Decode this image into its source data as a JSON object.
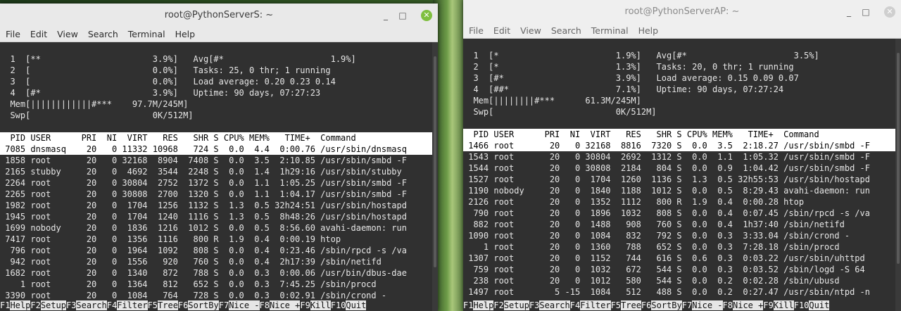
{
  "windows": [
    {
      "title": "root@PythonServerS: ~",
      "menu": [
        "File",
        "Edit",
        "View",
        "Search",
        "Terminal",
        "Help"
      ],
      "lines": [
        "  1  [**                      3.9%]   Avg[#*                     1.9%]",
        "  2  [                        0.0%]   Tasks: 25, 0 thr; 1 running",
        "  3  [                        0.0%]   Load average: 0.20 0.23 0.14",
        "  4  [#*                      3.9%]   Uptime: 90 days, 07:27:23",
        "  Mem[||||||||||||#***    97.7M/245M]",
        "  Swp[                        0K/512M]",
        "",
        "  PID USER      PRI  NI  VIRT   RES   SHR S CPU% MEM%   TIME+  Command",
        " 7085 dnsmasq    20   0 11332 10968   724 S  0.0  4.4  0:00.76 /usr/sbin/dnsmasq",
        " 1858 root       20   0 32168  8904  7408 S  0.0  3.5  2:10.85 /usr/sbin/smbd -F",
        " 2165 stubby     20   0  4692  3544  2248 S  0.0  1.4  1h29:16 /usr/sbin/stubby",
        " 2264 root       20   0 30804  2752  1372 S  0.0  1.1  1:05.25 /usr/sbin/smbd -F",
        " 2265 root       20   0 30808  2700  1320 S  0.0  1.1  1:04.17 /usr/sbin/smbd -F",
        " 1982 root       20   0  1704  1256  1132 S  1.3  0.5 32h24:51 /usr/sbin/hostapd",
        " 1945 root       20   0  1704  1240  1116 S  1.3  0.5  8h48:26 /usr/sbin/hostapd",
        " 1699 nobody     20   0  1836  1216  1012 S  0.0  0.5  8:56.60 avahi-daemon: run",
        " 7417 root       20   0  1356  1116   800 R  1.9  0.4  0:00.19 htop",
        "  796 root       20   0  1964  1092   808 S  0.0  0.4  0:23.46 /sbin/rpcd -s /va",
        "  942 root       20   0  1556   920   760 S  0.0  0.4  2h17:39 /sbin/netifd",
        " 1682 root       20   0  1340   872   788 S  0.0  0.3  0:00.06 /usr/bin/dbus-dae",
        "    1 root       20   0  1364   812   652 S  0.0  0.3  7:45.25 /sbin/procd",
        " 3390 root       20   0  1084   764   728 S  0.0  0.3  0:02.91 /sbin/crond -"
      ],
      "fkeys": [
        [
          "F1",
          "Help"
        ],
        [
          "F2",
          "Setup"
        ],
        [
          "F3",
          "Search"
        ],
        [
          "F4",
          "Filter"
        ],
        [
          "F5",
          "Tree"
        ],
        [
          "F6",
          "SortBy"
        ],
        [
          "F7",
          "Nice -"
        ],
        [
          "F8",
          "Nice +"
        ],
        [
          "F9",
          "Kill"
        ],
        [
          "F10",
          "Quit"
        ]
      ]
    },
    {
      "title": "root@PythonServerAP: ~",
      "menu": [
        "File",
        "Edit",
        "View",
        "Search",
        "Terminal",
        "Help"
      ],
      "lines": [
        "  1  [*                       1.9%]   Avg[#*                     3.5%]",
        "  2  [*                       1.3%]   Tasks: 20, 0 thr; 1 running",
        "  3  [#*                      3.9%]   Load average: 0.15 0.09 0.07",
        "  4  [##*                     7.1%]   Uptime: 90 days, 07:27:24",
        "  Mem[||||||||#***      61.3M/245M]",
        "  Swp[                        0K/512M]",
        "",
        "  PID USER      PRI  NI  VIRT   RES   SHR S CPU% MEM%   TIME+  Command",
        " 1466 root       20   0 32168  8816  7320 S  0.0  3.5  2:18.27 /usr/sbin/smbd -F",
        " 1543 root       20   0 30804  2692  1312 S  0.0  1.1  1:05.32 /usr/sbin/smbd -F",
        " 1544 root       20   0 30808  2184   804 S  0.0  0.9  1:04.42 /usr/sbin/smbd -F",
        " 1527 root       20   0  1704  1260  1136 S  1.3  0.5 32h55:53 /usr/sbin/hostapd",
        " 1190 nobody     20   0  1840  1188  1012 S  0.0  0.5  8:29.43 avahi-daemon: run",
        " 2126 root       20   0  1352  1112   800 R  1.9  0.4  0:00.28 htop",
        "  790 root       20   0  1896  1032   808 S  0.0  0.4  0:07.45 /sbin/rpcd -s /va",
        "  882 root       20   0  1488   908   760 S  0.0  0.4  1h37:40 /sbin/netifd",
        " 1090 root       20   0  1084   832   792 S  0.0  0.3  3:33.04 /sbin/crond -",
        "    1 root       20   0  1360   788   652 S  0.0  0.3  7:28.18 /sbin/procd",
        " 1307 root       20   0  1152   744   616 S  0.6  0.3  0:03.22 /usr/sbin/uhttpd",
        "  759 root       20   0  1032   672   544 S  0.0  0.3  0:03.52 /sbin/logd -S 64",
        "  238 root       20   0  1012   580   544 S  0.0  0.2  0:02.28 /sbin/ubusd",
        " 1497 root        5 -15  1084   512   488 S  0.0  0.2  0:27.47 /usr/sbin/ntpd -n"
      ],
      "fkeys": [
        [
          "F1",
          "Help"
        ],
        [
          "F2",
          "Setup"
        ],
        [
          "F3",
          "Search"
        ],
        [
          "F4",
          "Filter"
        ],
        [
          "F5",
          "Tree"
        ],
        [
          "F6",
          "SortBy"
        ],
        [
          "F7",
          "Nice -"
        ],
        [
          "F8",
          "Nice +"
        ],
        [
          "F9",
          "Kill"
        ],
        [
          "F10",
          "Quit"
        ]
      ]
    }
  ],
  "window_controls": {
    "minimize": "_",
    "maximize": "□",
    "close": "✕"
  }
}
